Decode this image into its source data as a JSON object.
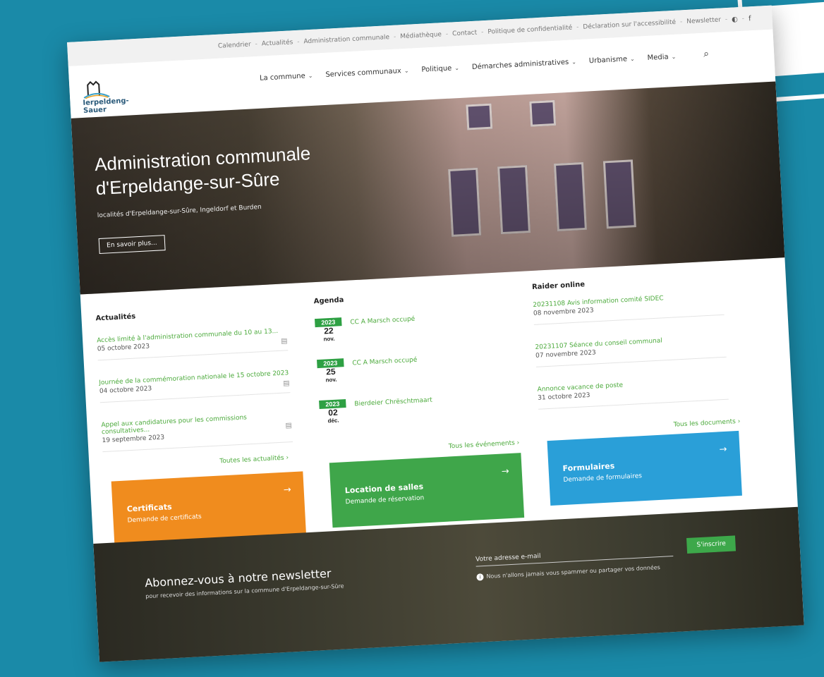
{
  "util_links": [
    "Calendrier",
    "Actualités",
    "Administration communale",
    "Médiathèque",
    "Contact",
    "Politique de confidentialité",
    "Déclaration sur l'accessibilité",
    "Newsletter"
  ],
  "logo": {
    "text": "Ierpeldeng-Sauer"
  },
  "nav": [
    "La commune",
    "Services communaux",
    "Politique",
    "Démarches administratives",
    "Urbanisme",
    "Media"
  ],
  "hero": {
    "title_line1": "Administration communale",
    "title_line2": "d'Erpeldange-sur-Sûre",
    "subtitle": "localités d'Erpeldange-sur-Sûre, Ingeldorf et Burden",
    "button": "En savoir plus..."
  },
  "news": {
    "title": "Actualités",
    "items": [
      {
        "title": "Accès limité à l'administration communale du 10 au 13...",
        "date": "05 octobre 2023"
      },
      {
        "title": "Journée de la commémoration nationale le 15 octobre 2023",
        "date": "04 octobre 2023"
      },
      {
        "title": "Appel aux candidatures pour les commissions consultatives...",
        "date": "19 septembre 2023"
      }
    ],
    "more": "Toutes les actualités"
  },
  "agenda": {
    "title": "Agenda",
    "items": [
      {
        "year": "2023",
        "day": "22",
        "month": "nov.",
        "title": "CC A Marsch occupé"
      },
      {
        "year": "2023",
        "day": "25",
        "month": "nov.",
        "title": "CC A Marsch occupé"
      },
      {
        "year": "2023",
        "day": "02",
        "month": "déc.",
        "title": "Bierdeier Chrëschtmaart"
      }
    ],
    "more": "Tous les événements"
  },
  "raider": {
    "title": "Raider online",
    "items": [
      {
        "title": "20231108 Avis information comité SIDEC",
        "date": "08 novembre 2023"
      },
      {
        "title": "20231107 Séance du conseil communal",
        "date": "07 novembre 2023"
      },
      {
        "title": "Annonce vacance de poste",
        "date": "31 octobre 2023"
      }
    ],
    "more": "Tous les documents"
  },
  "tiles": [
    {
      "title": "Certificats",
      "sub": "Demande de certificats",
      "color": "#f08c1e"
    },
    {
      "title": "Location de salles",
      "sub": "Demande de réservation",
      "color": "#3fa64a"
    },
    {
      "title": "Formulaires",
      "sub": "Demande de formulaires",
      "color": "#2a9fd8"
    }
  ],
  "newsletter": {
    "title": "Abonnez-vous à notre newsletter",
    "sub": "pour recevoir des informations sur la commune d'Erpeldange-sur-Sûre",
    "placeholder": "Votre adresse e-mail",
    "button": "S'inscrire",
    "note": "Nous n'allons jamais vous spammer ou partager vos données"
  }
}
